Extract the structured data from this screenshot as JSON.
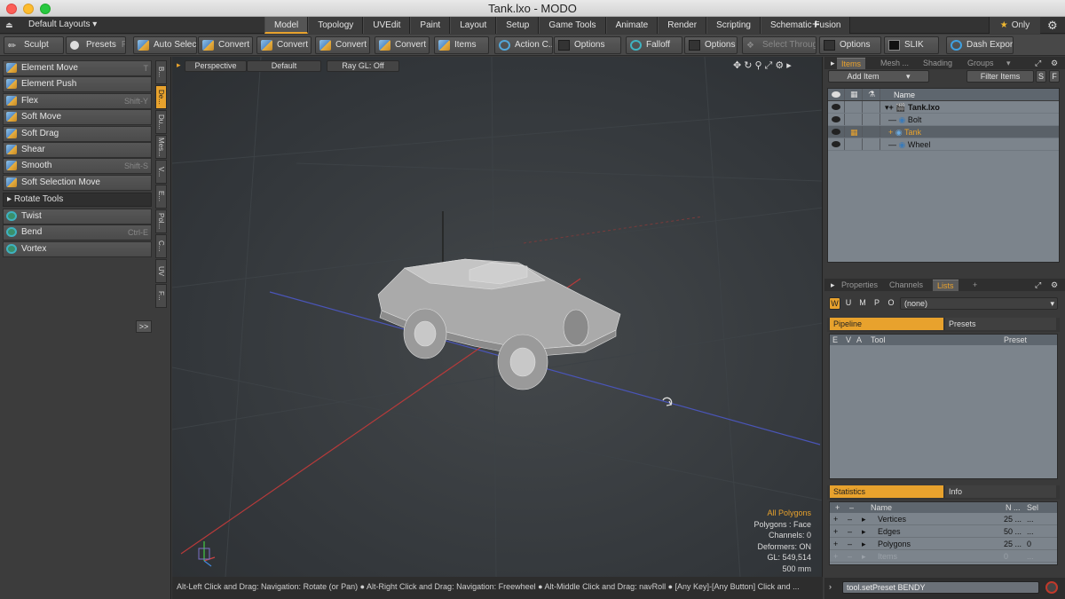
{
  "window": {
    "title": "Tank.lxo - MODO"
  },
  "layoutbar": {
    "layout_label": "Default Layouts ▾",
    "tabs": [
      "Model",
      "Topology",
      "UVEdit",
      "Paint",
      "Layout",
      "Setup",
      "Game Tools",
      "Animate",
      "Render",
      "Scripting",
      "Schematic Fusion"
    ],
    "active_tab": "Model",
    "plus": "+",
    "only_label": "Only"
  },
  "toolbar": {
    "sculpt": "Sculpt",
    "presets": "Presets",
    "presets_key": "F6",
    "auto_select": "Auto Select",
    "convert1": "Convert",
    "convert2": "Convert",
    "convert3": "Convert",
    "convert4": "Convert",
    "items": "Items",
    "action_center": "Action C...",
    "options1": "Options",
    "falloff": "Falloff",
    "options2": "Options",
    "select_through": "Select Through",
    "options3": "Options",
    "slik": "SLIK",
    "dash_export": "Dash Export"
  },
  "left_panel": {
    "tools": [
      {
        "label": "Element Move",
        "key": "T"
      },
      {
        "label": "Element Push",
        "key": ""
      },
      {
        "label": "Flex",
        "key": "Shift-Y"
      },
      {
        "label": "Soft Move",
        "key": ""
      },
      {
        "label": "Soft Drag",
        "key": ""
      },
      {
        "label": "Shear",
        "key": ""
      },
      {
        "label": "Smooth",
        "key": "Shift-S"
      },
      {
        "label": "Soft Selection Move",
        "key": ""
      }
    ],
    "rotate_header": "Rotate Tools",
    "rotate_tools": [
      {
        "label": "Twist",
        "key": ""
      },
      {
        "label": "Bend",
        "key": "Ctrl-E"
      },
      {
        "label": "Vortex",
        "key": ""
      }
    ],
    "more_button": ">>",
    "vertical_tabs": [
      "B...",
      "De...",
      "Du...",
      "Mes...",
      "V...",
      "E...",
      "Pol...",
      "C...",
      "UV",
      "F..."
    ]
  },
  "viewport": {
    "view_mode": "Perspective",
    "shading": "Default",
    "raygl": "Ray GL: Off",
    "stats": {
      "all_polygons": "All Polygons",
      "polygons": "Polygons : Face",
      "channels": "Channels: 0",
      "deformers": "Deformers: ON",
      "gl": "GL: 549,514",
      "size": "500 mm"
    }
  },
  "statusbar": {
    "text": "Alt-Left Click and Drag: Navigation: Rotate (or Pan) ●  Alt-Right Click and Drag: Navigation: Freewheel ●  Alt-Middle Click and Drag: navRoll ●  [Any Key]-[Any Button] Click and ..."
  },
  "items_panel": {
    "tabs": [
      "Items",
      "Mesh ...",
      "Shading",
      "Groups"
    ],
    "active_tab": "Items",
    "add_item": "Add Item",
    "filter_items": "Filter Items",
    "s_btn": "S",
    "f_btn": "F",
    "name_col": "Name",
    "rows": [
      {
        "name": "Tank.lxo",
        "indent": 0
      },
      {
        "name": "Bolt",
        "indent": 1
      },
      {
        "name": "Tank",
        "indent": 1
      },
      {
        "name": "Wheel",
        "indent": 1
      }
    ]
  },
  "lists_panel": {
    "tabs": [
      "Properties",
      "Channels",
      "Lists"
    ],
    "active_tab": "Lists",
    "mode_buttons": [
      "W",
      "U",
      "M",
      "P",
      "O"
    ],
    "mode_value": "(none)",
    "pipeline_tab": "Pipeline",
    "presets_tab": "Presets",
    "pipe_cols": [
      "E",
      "V",
      "A",
      "Tool",
      "Preset"
    ],
    "statistics_tab": "Statistics",
    "info_tab": "Info",
    "stat_cols": [
      "Name",
      "N ...",
      "Sel"
    ],
    "stat_rows": [
      {
        "name": "Vertices",
        "n": "25 ...",
        "sel": "..."
      },
      {
        "name": "Edges",
        "n": "50 ...",
        "sel": "..."
      },
      {
        "name": "Polygons",
        "n": "25 ...",
        "sel": "0"
      },
      {
        "name": "Items",
        "n": "0",
        "sel": "..."
      }
    ]
  },
  "command": {
    "value": "tool.setPreset BENDY"
  },
  "colors": {
    "accent": "#e8a22d",
    "panel": "#3a3a3a",
    "list_bg": "#7c848c"
  }
}
